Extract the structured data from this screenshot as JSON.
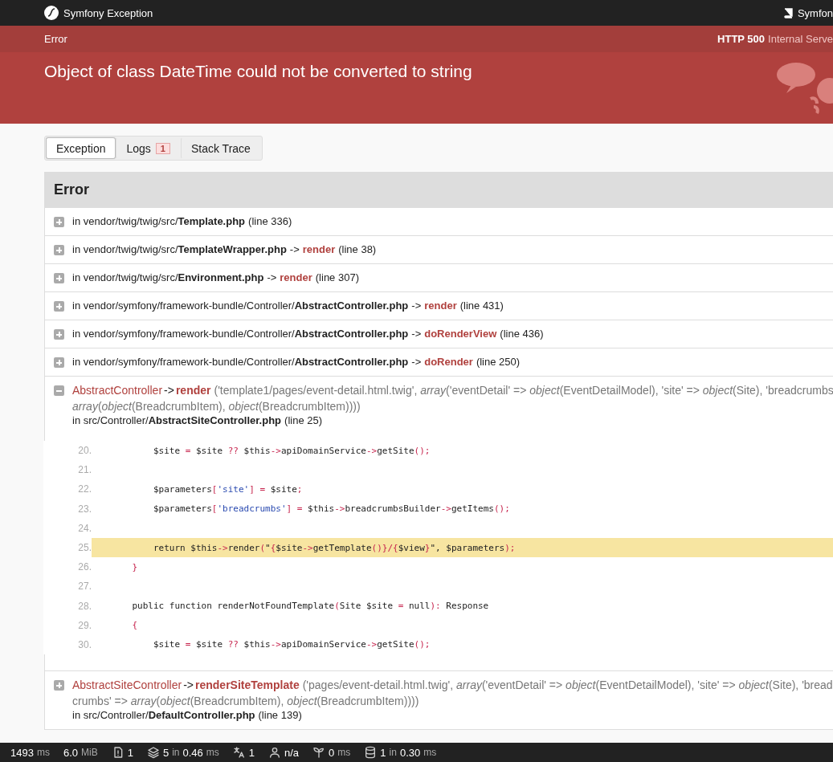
{
  "topbar": {
    "title": "Symfony Exception",
    "link": "Symfon"
  },
  "status_bar": {
    "label": "Error",
    "code": "HTTP 500",
    "text": "Internal Serve"
  },
  "exception": {
    "message": "Object of class DateTime could not be converted to string"
  },
  "tabs": [
    {
      "label": "Exception",
      "selected": true
    },
    {
      "label": "Logs",
      "badge": "1",
      "selected": false
    },
    {
      "label": "Stack Trace",
      "selected": false
    }
  ],
  "trace": {
    "title": "Error",
    "frames": [
      {
        "expanded": false,
        "path": "in vendor/twig/twig/src/",
        "file": "Template.php",
        "line": "(line 336)"
      },
      {
        "expanded": false,
        "path": "in vendor/twig/twig/src/",
        "file": "TemplateWrapper.php",
        "arrow": "->",
        "function": "render",
        "line": "(line 38)"
      },
      {
        "expanded": false,
        "path": "in vendor/twig/twig/src/",
        "file": "Environment.php",
        "arrow": "->",
        "function": "render",
        "line": "(line 307)"
      },
      {
        "expanded": false,
        "path": "in vendor/symfony/framework-bundle/Controller/",
        "file": "AbstractController.php",
        "arrow": "->",
        "function": "render",
        "line": "(line 431)"
      },
      {
        "expanded": false,
        "path": "in vendor/symfony/framework-bundle/Controller/",
        "file": "AbstractController.php",
        "arrow": "->",
        "function": "doRenderView",
        "line": "(line 436)"
      },
      {
        "expanded": false,
        "path": "in vendor/symfony/framework-bundle/Controller/",
        "file": "AbstractController.php",
        "arrow": "->",
        "function": "doRender",
        "line": "(line 250)"
      },
      {
        "expanded": true,
        "class": "AbstractController",
        "arrow": "->",
        "function": "render",
        "args": [
          "('template1/pages/event-detail.html.twig', *array*('eventDetail' => *object*(EventDetailModel), 'site' => *object*(Site), 'breadcrumbs",
          "*array*(*object*(BreadcrumbItem), *object*(BreadcrumbItem))))"
        ],
        "path": "in src/Controller/",
        "file": "AbstractSiteController.php",
        "line": "(line 25)",
        "code": [
          {
            "number": "20.",
            "highlighted": false,
            "text": "        $site = $site ?? $this->apiDomainService->getSite();"
          },
          {
            "number": "21.",
            "highlighted": false
          },
          {
            "number": "22.",
            "highlighted": false,
            "text": "        $parameters['site'] = $site;"
          },
          {
            "number": "23.",
            "highlighted": false,
            "text": "        $parameters['breadcrumbs'] = $this->breadcrumbsBuilder->getItems();"
          },
          {
            "number": "24.",
            "highlighted": false
          },
          {
            "number": "25.",
            "highlighted": true,
            "text": "        return $this->render(\"{$site->getTemplate()}/{$view}\", $parameters);"
          },
          {
            "number": "26.",
            "highlighted": false,
            "text": "    }"
          },
          {
            "number": "27.",
            "highlighted": false
          },
          {
            "number": "28.",
            "highlighted": false,
            "text": "    public function renderNotFoundTemplate(Site $site = null): Response"
          },
          {
            "number": "29.",
            "highlighted": false,
            "text": "    {"
          },
          {
            "number": "30.",
            "highlighted": false,
            "text": "        $site = $site ?? $this->apiDomainService->getSite();"
          }
        ]
      },
      {
        "expanded": false,
        "class": "AbstractSiteController",
        "arrow": "->",
        "function": "renderSiteTemplate",
        "args": [
          "('pages/event-detail.html.twig', *array*('eventDetail' => *object*(EventDetailModel), 'site' => *object*(Site), 'bread",
          "crumbs' => *array*(*object*(BreadcrumbItem), *object*(BreadcrumbItem))))"
        ],
        "path": "in src/Controller/",
        "file": "DefaultController.php",
        "line": "(line 139)"
      }
    ]
  },
  "toolbar": [
    {
      "kind": "time",
      "value": "1493",
      "unit": "ms"
    },
    {
      "kind": "memory",
      "value": "6.0",
      "unit": "MiB"
    },
    {
      "kind": "logs",
      "value": "1"
    },
    {
      "kind": "twig",
      "value": "5",
      "sep": "in",
      "value2": "0.46",
      "unit": "ms"
    },
    {
      "kind": "translation",
      "value": "1"
    },
    {
      "kind": "user",
      "value": "n/a"
    },
    {
      "kind": "events",
      "value": "0",
      "unit": "ms"
    },
    {
      "kind": "db",
      "value": "1",
      "sep": "in",
      "value2": "0.30",
      "unit": "ms"
    }
  ]
}
